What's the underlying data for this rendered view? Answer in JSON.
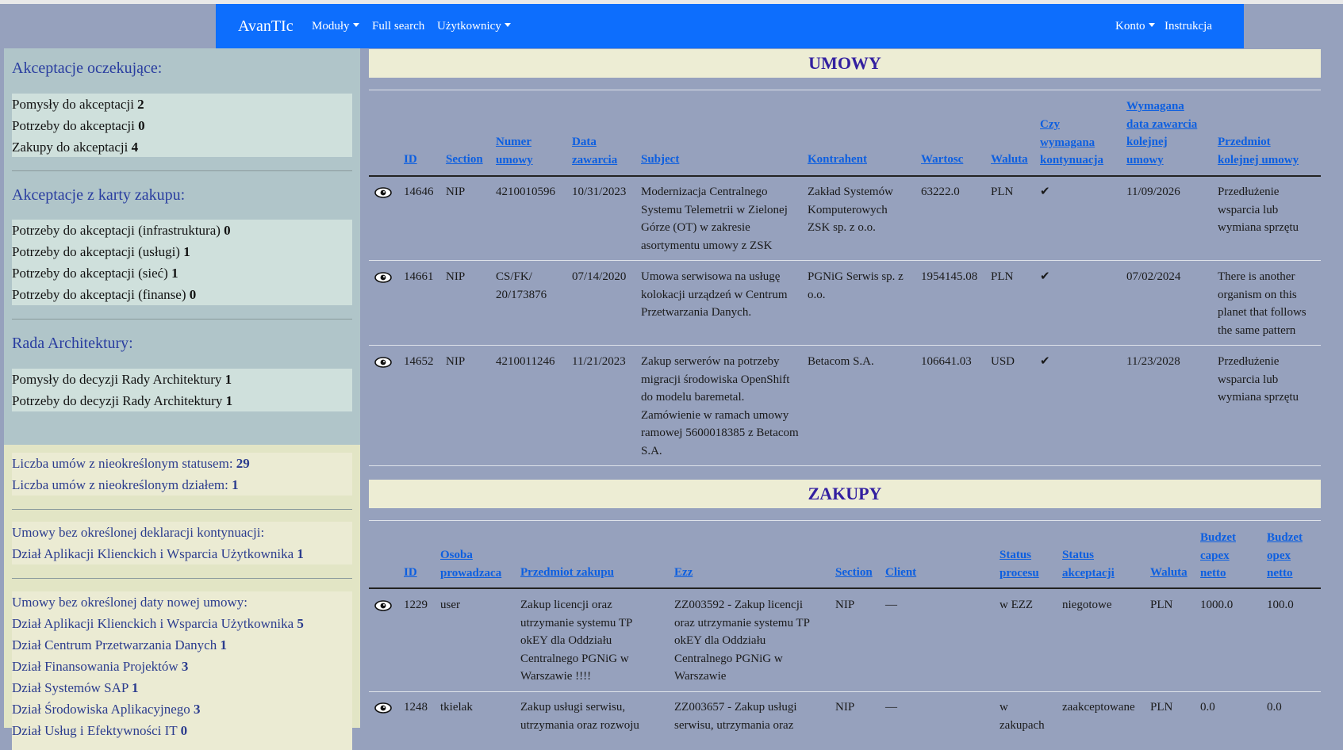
{
  "navbar": {
    "brand": "AvanTIc",
    "moduly": "Moduły",
    "full_search": "Full search",
    "uzytkownicy": "Użytkownicy",
    "konto": "Konto",
    "instrukcja": "Instrukcja"
  },
  "sidebar": {
    "pending_title": "Akceptacje oczekujące:",
    "pending": [
      {
        "label": "Pomysły do akceptacji",
        "count": "2"
      },
      {
        "label": "Potrzeby do akceptacji",
        "count": "0"
      },
      {
        "label": "Zakupy do akceptacji",
        "count": "4"
      }
    ],
    "card_title": "Akceptacje z karty zakupu:",
    "card": [
      {
        "label": "Potrzeby do akceptacji (infrastruktura)",
        "count": "0"
      },
      {
        "label": "Potrzeby do akceptacji (usługi)",
        "count": "1"
      },
      {
        "label": "Potrzeby do akceptacji (sieć)",
        "count": "1"
      },
      {
        "label": "Potrzeby do akceptacji (finanse)",
        "count": "0"
      }
    ],
    "arch_title": "Rada Architektury:",
    "arch": [
      {
        "label": "Pomysły do decyzji Rady Architektury",
        "count": "1"
      },
      {
        "label": "Potrzeby do decyzji Rady Architektury",
        "count": "1"
      }
    ],
    "stats": [
      {
        "label": "Liczba umów z nieokreślonym statusem:",
        "count": "29"
      },
      {
        "label": "Liczba umów z nieokreślonym działem:",
        "count": "1"
      }
    ],
    "no_continuation_title": "Umowy bez określonej deklaracji kontynuacji:",
    "no_continuation": [
      {
        "label": "Dział Aplikacji Klienckich i Wsparcia Użytkownika",
        "count": "1"
      }
    ],
    "no_date_title": "Umowy bez określonej daty nowej umowy:",
    "no_date": [
      {
        "label": "Dział Aplikacji Klienckich i Wsparcia Użytkownika",
        "count": "5"
      },
      {
        "label": "Dział Centrum Przetwarzania Danych",
        "count": "1"
      },
      {
        "label": "Dział Finansowania Projektów",
        "count": "3"
      },
      {
        "label": "Dział Systemów SAP",
        "count": "1"
      },
      {
        "label": "Dział Środowiska Aplikacyjnego",
        "count": "3"
      },
      {
        "label": "Dział Usług i Efektywności IT",
        "count": "0"
      }
    ]
  },
  "umowy": {
    "title": "UMOWY",
    "headers": {
      "id": "ID",
      "section": "Section",
      "numer": "Numer umowy",
      "data": "Data zawarcia",
      "subject": "Subject",
      "kontrahent": "Kontrahent",
      "wartosc": "Wartosc",
      "waluta": "Waluta",
      "kontynuacja": "Czy wymagana kontynuacja",
      "wymagana_data": "Wymagana data zawarcia kolejnej umowy",
      "przedmiot": "Przedmiot kolejnej umowy"
    },
    "rows": [
      {
        "id": "14646",
        "section": "NIP",
        "numer": "4210010596",
        "data": "10/31/2023",
        "subject": "Modernizacja Centralnego Systemu Telemetrii w Zielonej Górze (OT) w zakresie asortymentu umowy z ZSK",
        "kontrahent": "Zakład Systemów Komputerowych ZSK sp. z o.o.",
        "wartosc": "63222.0",
        "waluta": "PLN",
        "kontynuacja": "✔",
        "wymagana_data": "11/09/2026",
        "przedmiot": "Przedłużenie wsparcia lub wymiana sprzętu"
      },
      {
        "id": "14661",
        "section": "NIP",
        "numer": "CS/FK/ 20/173876",
        "data": "07/14/2020",
        "subject": "Umowa serwisowa na usługę kolokacji urządzeń w Centrum Przetwarzania Danych.",
        "kontrahent": "PGNiG Serwis sp. z o.o.",
        "wartosc": "1954145.08",
        "waluta": "PLN",
        "kontynuacja": "✔",
        "wymagana_data": "07/02/2024",
        "przedmiot": "There is another organism on this planet that follows the same pattern"
      },
      {
        "id": "14652",
        "section": "NIP",
        "numer": "4210011246",
        "data": "11/21/2023",
        "subject": "Zakup serwerów na potrzeby migracji środowiska OpenShift do modelu baremetal. Zamówienie w ramach umowy ramowej 5600018385 z Betacom S.A.",
        "kontrahent": "Betacom S.A.",
        "wartosc": "106641.03",
        "waluta": "USD",
        "kontynuacja": "✔",
        "wymagana_data": "11/23/2028",
        "przedmiot": "Przedłużenie wsparcia lub wymiana sprzętu"
      }
    ]
  },
  "zakupy": {
    "title": "ZAKUPY",
    "headers": {
      "id": "ID",
      "osoba": "Osoba prowadzaca",
      "przedmiot": "Przedmiot zakupu",
      "ezz": "Ezz",
      "section": "Section",
      "client": "Client",
      "status_procesu": "Status procesu",
      "status_akceptacji": "Status akceptacji",
      "waluta": "Waluta",
      "capex": "Budzet capex netto",
      "opex": "Budzet opex netto"
    },
    "rows": [
      {
        "id": "1229",
        "osoba": "user",
        "przedmiot": "Zakup licencji oraz utrzymanie systemu TP okEY dla Oddziału Centralnego PGNiG w Warszawie !!!!",
        "ezz": "ZZ003592 - Zakup licencji oraz utrzymanie systemu TP okEY dla Oddziału Centralnego PGNiG w Warszawie",
        "section": "NIP",
        "client": "—",
        "status_procesu": "w EZZ",
        "status_akceptacji": "niegotowe",
        "waluta": "PLN",
        "capex": "1000.0",
        "opex": "100.0"
      },
      {
        "id": "1248",
        "osoba": "tkielak",
        "przedmiot": "Zakup usługi serwisu, utrzymania oraz rozwoju",
        "ezz": "ZZ003657 - Zakup usługi serwisu, utrzymania oraz",
        "section": "NIP",
        "client": "—",
        "status_procesu": "w zakupach",
        "status_akceptacji": "zaakceptowane",
        "waluta": "PLN",
        "capex": "0.0",
        "opex": "0.0"
      }
    ]
  }
}
